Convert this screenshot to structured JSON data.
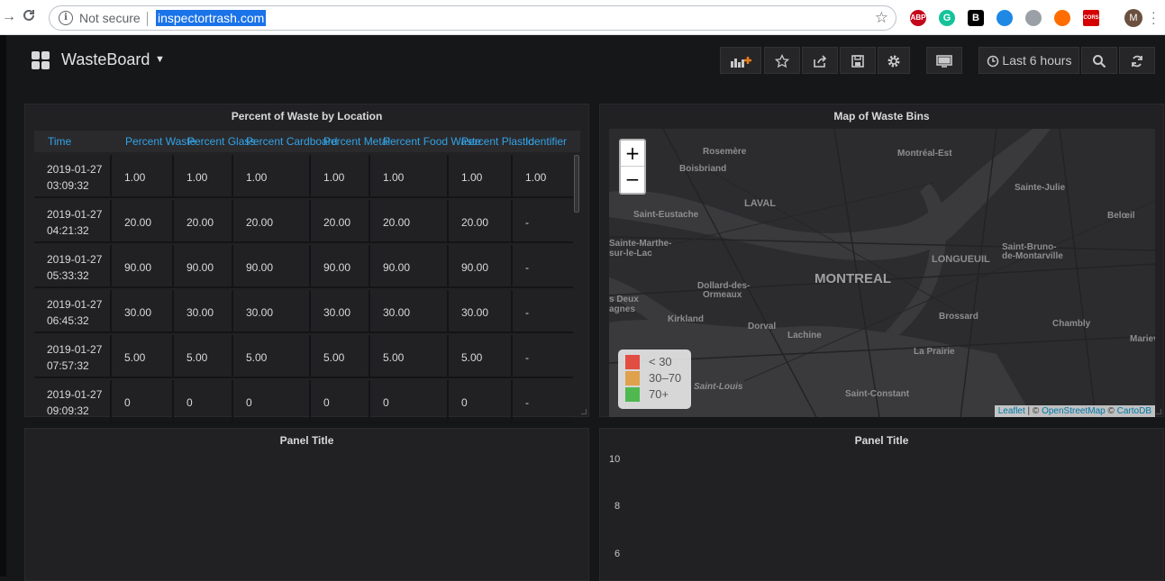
{
  "browser": {
    "status": "Not secure",
    "url": "inspectortrash.com",
    "extensions": [
      {
        "name": "ABP",
        "label": "ABP",
        "color": "#c4071c"
      },
      {
        "name": "grammarly",
        "label": "G",
        "color": "#15c39a"
      },
      {
        "name": "block",
        "label": "B",
        "color": "#000000"
      },
      {
        "name": "ext-blue",
        "label": "",
        "color": "#1e88e5"
      },
      {
        "name": "eye",
        "label": "",
        "color": "#5f6368"
      },
      {
        "name": "ext-orange",
        "label": "",
        "color": "#ff6d00"
      },
      {
        "name": "cors",
        "label": "CORS",
        "color": "#d50000"
      }
    ],
    "avatar": "M"
  },
  "dashboard": {
    "title": "WasteBoard",
    "time_range": "Last 6 hours"
  },
  "table_panel": {
    "title": "Percent of Waste by Location",
    "columns": [
      "Time",
      "Percent Waste",
      "Percent Glass",
      "Percent Cardboard",
      "Percent Metal",
      "Percent Food Waste",
      "Percent Plastic",
      "Identifier"
    ],
    "rows": [
      {
        "date": "2019-01-27",
        "time": "03:09:32",
        "values": [
          "1.00",
          "1.00",
          "1.00",
          "1.00",
          "1.00",
          "1.00",
          "1.00"
        ]
      },
      {
        "date": "2019-01-27",
        "time": "04:21:32",
        "values": [
          "20.00",
          "20.00",
          "20.00",
          "20.00",
          "20.00",
          "20.00",
          "-"
        ]
      },
      {
        "date": "2019-01-27",
        "time": "05:33:32",
        "values": [
          "90.00",
          "90.00",
          "90.00",
          "90.00",
          "90.00",
          "90.00",
          "-"
        ]
      },
      {
        "date": "2019-01-27",
        "time": "06:45:32",
        "values": [
          "30.00",
          "30.00",
          "30.00",
          "30.00",
          "30.00",
          "30.00",
          "-"
        ]
      },
      {
        "date": "2019-01-27",
        "time": "07:57:32",
        "values": [
          "5.00",
          "5.00",
          "5.00",
          "5.00",
          "5.00",
          "5.00",
          "-"
        ]
      },
      {
        "date": "2019-01-27",
        "time": "09:09:32",
        "values": [
          "0",
          "0",
          "0",
          "0",
          "0",
          "0",
          "-"
        ]
      }
    ]
  },
  "map_panel": {
    "title": "Map of Waste Bins",
    "zoom_in": "+",
    "zoom_out": "−",
    "legend": [
      {
        "label": "< 30",
        "color": "#e24d42"
      },
      {
        "label": "30–70",
        "color": "#e0a14c"
      },
      {
        "label": "70+",
        "color": "#4fb84f"
      }
    ],
    "attribution": {
      "leaflet": "Leaflet",
      "sep1": " | © ",
      "osm": "OpenStreetMap",
      "sep2": " © ",
      "carto": "CartoDB"
    },
    "places": {
      "rosemere": "Rosemère",
      "boisbriand": "Boisbriand",
      "montreal_est": "Montréal-Est",
      "sainte_julie": "Sainte-Julie",
      "laval": "LAVAL",
      "saint_eustache": "Saint-Eustache",
      "beloeil": "Belœil",
      "sainte_marthe_1": "Sainte-Marthe-",
      "sainte_marthe_2": "sur-le-Lac",
      "longueuil": "LONGUEUIL",
      "saint_bruno_1": "Saint-Bruno-",
      "saint_bruno_2": "de-Montarville",
      "montreal": "MONTREAL",
      "dollard_1": "Dollard-des-",
      "dollard_2": "Ormeaux",
      "les_deux_1": "s Deux",
      "les_deux_2": "agnes",
      "kirkland": "Kirkland",
      "dorval": "Dorval",
      "brossard": "Brossard",
      "chambly": "Chambly",
      "lachine": "Lachine",
      "marieville": "Mariev",
      "la_prairie": "La Prairie",
      "saint_louis": "Saint-Louis",
      "saint_constant": "Saint-Constant"
    }
  },
  "bottom_left_panel": {
    "title": "Panel Title"
  },
  "bottom_right_panel": {
    "title": "Panel Title",
    "y_ticks": [
      "10",
      "8",
      "6"
    ]
  }
}
